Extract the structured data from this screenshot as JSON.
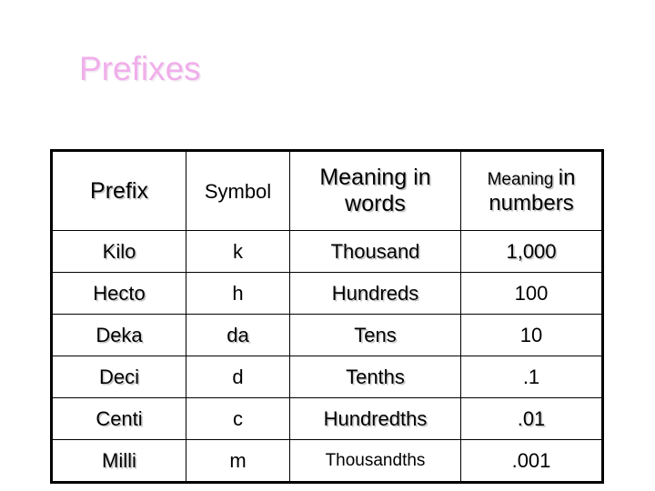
{
  "slide": {
    "title": "Prefixes",
    "title_color": "#f0aeea",
    "background_color": "#ffffff"
  },
  "table": {
    "headers": {
      "prefix": "Prefix",
      "symbol": "Symbol",
      "meaning_words_line1": "Meaning in",
      "meaning_words_line2": "words",
      "meaning_numbers_word": "Meaning",
      "meaning_numbers_in": "in",
      "meaning_numbers_line2": "numbers"
    },
    "rows": [
      {
        "prefix": "Kilo",
        "symbol": "k",
        "words": "Thousand",
        "numbers": "1,000"
      },
      {
        "prefix": "Hecto",
        "symbol": "h",
        "words": "Hundreds",
        "numbers": "100"
      },
      {
        "prefix": "Deka",
        "symbol": "da",
        "words": "Tens",
        "numbers": "10"
      },
      {
        "prefix": "Deci",
        "symbol": "d",
        "words": "Tenths",
        "numbers": ".1"
      },
      {
        "prefix": "Centi",
        "symbol": "c",
        "words": "Hundredths",
        "numbers": ".01"
      },
      {
        "prefix": "Milli",
        "symbol": "m",
        "words": "Thousandths",
        "numbers": ".001"
      }
    ]
  }
}
